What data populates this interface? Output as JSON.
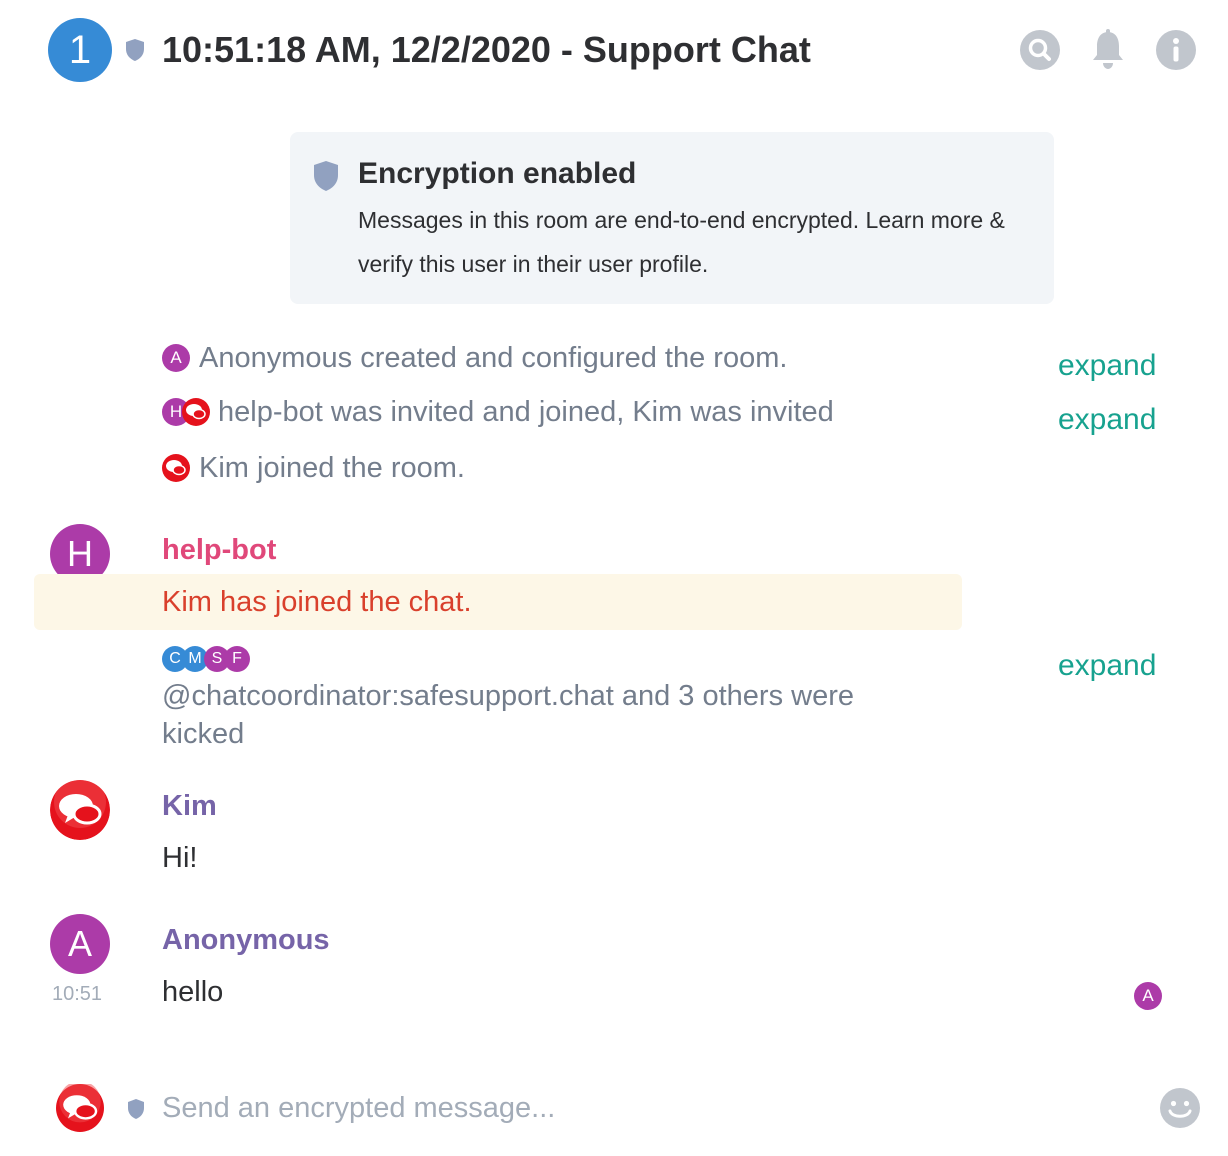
{
  "header": {
    "avatar_letter": "1",
    "title": "10:51:18 AM, 12/2/2020 - Support Chat",
    "icons": [
      "shield-icon",
      "search-icon",
      "bell-icon",
      "info-icon"
    ]
  },
  "encryption": {
    "title": "Encryption enabled",
    "description": "Messages in this room are end-to-end encrypted. Learn more & verify this user in their user profile."
  },
  "events": [
    {
      "avatars": [
        "A"
      ],
      "text": "Anonymous created and configured the room.",
      "expand": "expand"
    },
    {
      "avatars": [
        "H",
        "kim"
      ],
      "text": "help-bot was invited and joined, Kim was invited",
      "expand": "expand"
    },
    {
      "avatars": [
        "kim"
      ],
      "text": "Kim joined the room."
    }
  ],
  "messages": [
    {
      "sender": "help-bot",
      "avatar_letter": "H",
      "body": "Kim has joined the chat."
    },
    {
      "sender": "Kim",
      "body": "Hi!"
    },
    {
      "sender": "Anonymous",
      "avatar_letter": "A",
      "body": "hello",
      "time": "10:51",
      "receipt": "A"
    }
  ],
  "kicked_summary": {
    "avatars": [
      "C",
      "M",
      "S",
      "F"
    ],
    "line1": "@chatcoordinator:safesupport.chat and 3 others were",
    "line2": "kicked",
    "expand": "expand"
  },
  "composer": {
    "placeholder": "Send an encrypted message..."
  },
  "colors": {
    "accent": "#17a28f",
    "helpbot_name": "#e0487a",
    "highlight_text": "#d9402c",
    "kim_name": "#7664a8",
    "purple_avatar": "#ac3ba8",
    "blue_avatar": "#368bd6"
  }
}
